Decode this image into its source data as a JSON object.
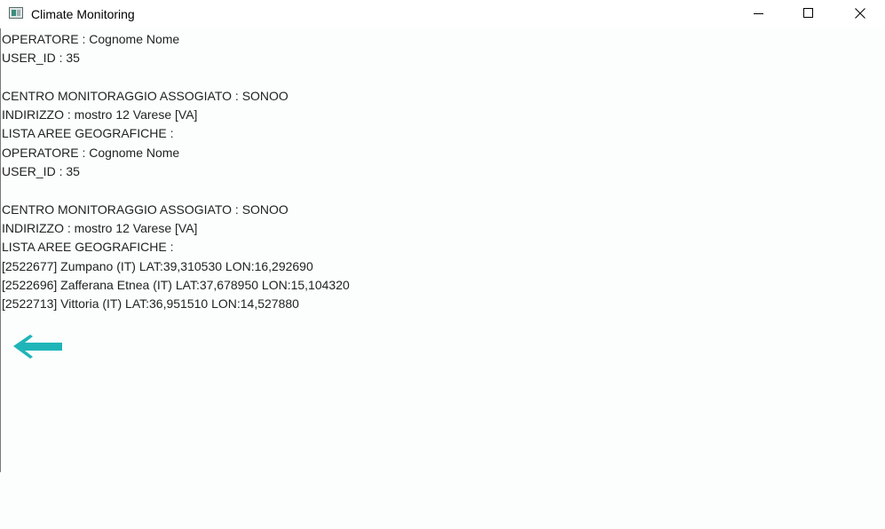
{
  "window": {
    "title": "Climate Monitoring",
    "controls": {
      "minimize": "minimize-icon",
      "maximize": "maximize-icon",
      "close": "close-icon"
    }
  },
  "blocks": [
    {
      "operator": "OPERATORE : Cognome Nome",
      "user_id": "USER_ID : 35",
      "center": "CENTRO MONITORAGGIO ASSOGIATO : SONOO",
      "address": "INDIRIZZO : mostro 12 Varese [VA]",
      "areas_label": "LISTA AREE GEOGRAFICHE :"
    },
    {
      "operator": "OPERATORE : Cognome Nome",
      "user_id": "USER_ID : 35",
      "center": "CENTRO MONITORAGGIO ASSOGIATO : SONOO",
      "address": "INDIRIZZO : mostro 12 Varese [VA]",
      "areas_label": "LISTA AREE GEOGRAFICHE :",
      "areas": [
        "[2522677] Zumpano (IT) LAT:39,310530 LON:16,292690",
        "[2522696] Zafferana Etnea (IT) LAT:37,678950 LON:15,104320",
        "[2522713] Vittoria (IT) LAT:36,951510 LON:14,527880"
      ]
    }
  ],
  "back_button": {
    "icon": "arrow-left-icon",
    "color": "#1fb5b8"
  },
  "colors": {
    "background": "#fcfdfd",
    "text": "#222222",
    "accent": "#1fb5b8"
  }
}
